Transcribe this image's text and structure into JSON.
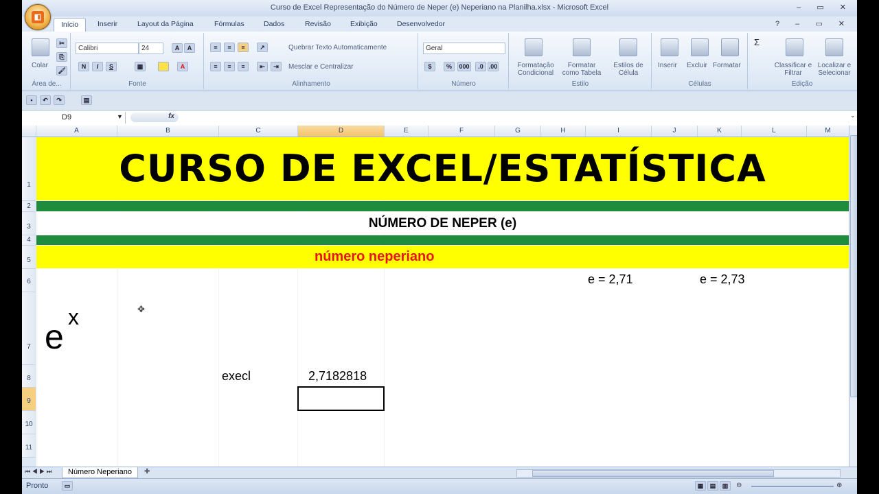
{
  "window": {
    "title": "Curso de Excel Representação do Número de Neper (e) Neperiano na Planilha.xlsx - Microsoft Excel",
    "controls": "– ▭ ✕"
  },
  "ribbon_tabs": [
    "Início",
    "Inserir",
    "Layout da Página",
    "Fórmulas",
    "Dados",
    "Revisão",
    "Exibição",
    "Desenvolvedor"
  ],
  "ribbon": {
    "clipboard": {
      "paste_label": "Colar",
      "group_label": "Área de..."
    },
    "font": {
      "name": "Calibri",
      "size": "24",
      "bold": "N",
      "italic": "I",
      "underline": "S",
      "group_label": "Fonte"
    },
    "alignment": {
      "wrap_label": "Quebrar Texto Automaticamente",
      "merge_label": "Mesclar e Centralizar",
      "group_label": "Alinhamento"
    },
    "number": {
      "format": "Geral",
      "percent": "%",
      "thousands": "000",
      "group_label": "Número"
    },
    "styles": {
      "conditional": "Formatação Condicional",
      "as_table": "Formatar como Tabela",
      "cell_styles": "Estilos de Célula",
      "group_label": "Estilo"
    },
    "cells": {
      "insert": "Inserir",
      "delete": "Excluir",
      "format": "Formatar",
      "group_label": "Células"
    },
    "editing": {
      "sort": "Classificar e Filtrar",
      "find": "Localizar e Selecionar",
      "sum_icon": "Σ",
      "group_label": "Edição"
    }
  },
  "formula_bar": {
    "name_box": "D9",
    "fx": "fx",
    "value": ""
  },
  "columns": [
    "A",
    "B",
    "C",
    "D",
    "E",
    "F",
    "G",
    "H",
    "I",
    "J",
    "K",
    "L",
    "M"
  ],
  "selected_column": "D",
  "rows": [
    "1",
    "2",
    "3",
    "4",
    "5",
    "6",
    "7",
    "8",
    "9",
    "10",
    "11"
  ],
  "selected_row": "9",
  "cells": {
    "title": "CURSO DE EXCEL/ESTATÍSTICA",
    "subtitle": "NÚMERO DE NEPER (e)",
    "neperiano": "número neperiano",
    "e1": "e = 2,71",
    "e2": "e = 2,73",
    "ex_base": "e",
    "ex_exp": "x",
    "execl_label": "execl",
    "execl_value": "2,7182818"
  },
  "sheet_tabs": {
    "active": "Número Neperiano"
  },
  "status": {
    "ready": "Pronto"
  },
  "colors": {
    "yellow": "#ffff00",
    "green": "#1e8c3c",
    "red": "#e8141c"
  }
}
